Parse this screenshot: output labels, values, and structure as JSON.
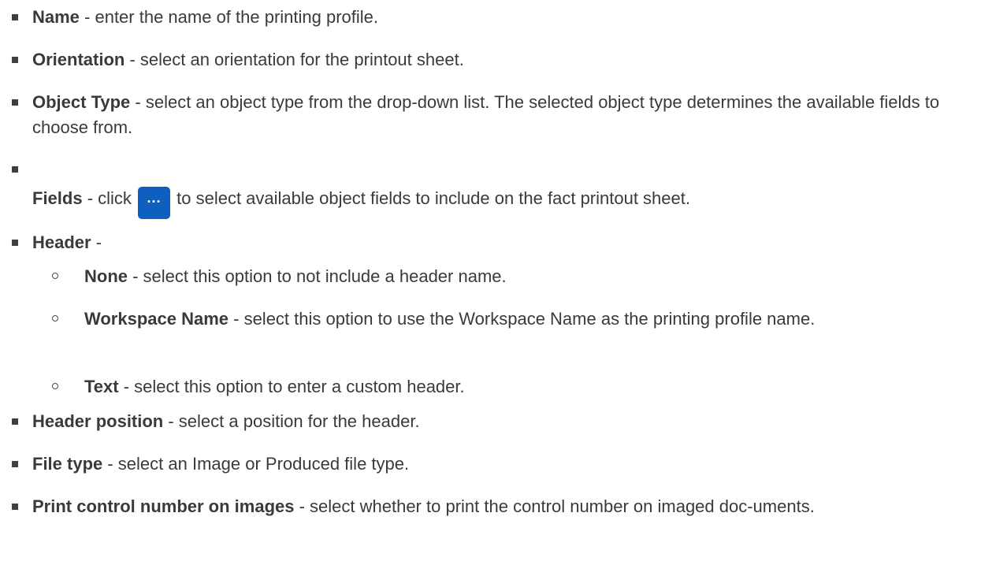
{
  "items": [
    {
      "term": "Name",
      "desc": " - enter the name of the printing profile."
    },
    {
      "term": "Orientation",
      "desc": " - select an orientation for the printout sheet."
    },
    {
      "term": "Object Type",
      "desc": " - select an object type from the drop-down list. The selected object type determines the available fields to choose from."
    },
    {
      "term": "Fields",
      "desc_before": " - click ",
      "button_label": "...",
      "button_icon": "ellipsis-icon",
      "desc_after": " to select available object fields to include on the fact printout sheet."
    },
    {
      "term": "Header",
      "desc": " -"
    },
    {
      "term": "Header position",
      "desc": " - select a position for the header."
    },
    {
      "term": "File type",
      "desc": " - select an Image or Produced file type."
    },
    {
      "term": "Print control number on images",
      "desc": " - select whether to print the control number on imaged doc-uments."
    }
  ],
  "header_options": [
    {
      "term": "None",
      "desc": " - select this option to not include a header name."
    },
    {
      "term": "Workspace Name",
      "desc": " - select this option to use the Workspace Name as the printing profile name."
    },
    {
      "term": "Text",
      "desc": " - select this option to enter a custom header."
    }
  ],
  "colors": {
    "text": "#3a3a3a",
    "button": "#0e60c0"
  }
}
